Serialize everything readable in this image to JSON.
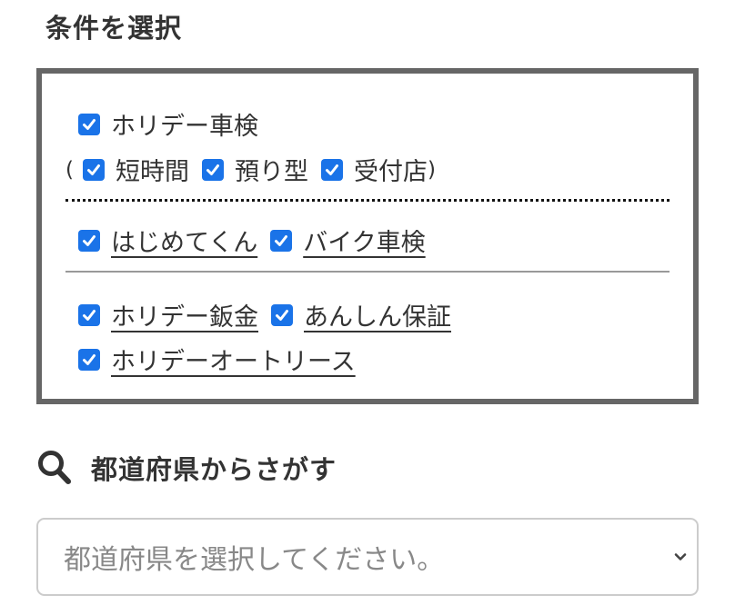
{
  "conditions": {
    "title": "条件を選択",
    "holiday_shaken": {
      "label": "ホリデー車検",
      "checked": true
    },
    "paren_open": "(",
    "paren_close": ")",
    "sub_options": [
      {
        "label": "短時間",
        "checked": true
      },
      {
        "label": "預り型",
        "checked": true
      },
      {
        "label": "受付店",
        "checked": true
      }
    ],
    "group2": [
      {
        "label": "はじめてくん",
        "checked": true
      },
      {
        "label": "バイク車検",
        "checked": true
      }
    ],
    "group3": [
      {
        "label": "ホリデー鈑金",
        "checked": true
      },
      {
        "label": "あんしん保証",
        "checked": true
      },
      {
        "label": "ホリデーオートリース",
        "checked": true
      }
    ]
  },
  "prefecture_search": {
    "title": "都道府県からさがす",
    "icon": "search-icon",
    "select_placeholder": "都道府県を選択してください。"
  },
  "colors": {
    "checkbox": "#1a73e8",
    "border": "#666666"
  }
}
